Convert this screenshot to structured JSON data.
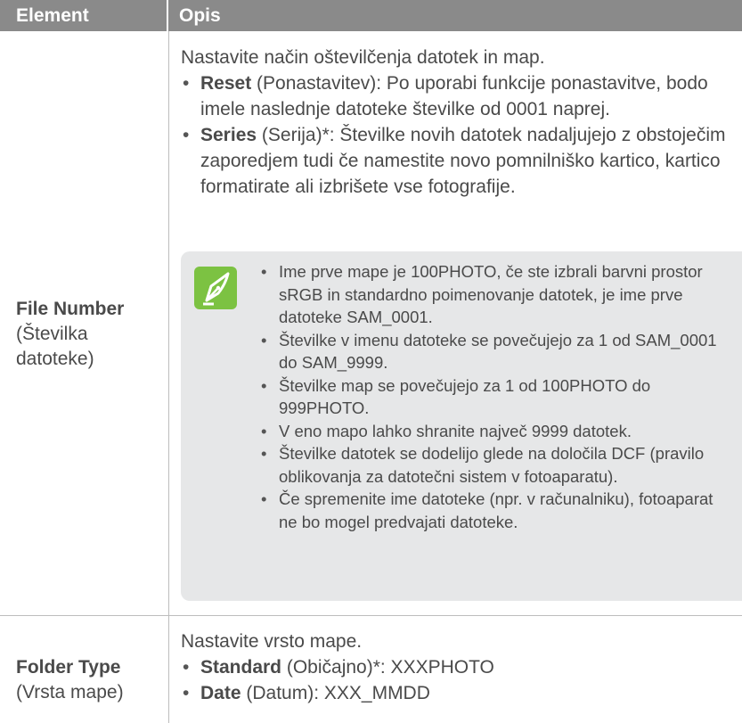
{
  "header": {
    "col1": "Element",
    "col2": "Opis"
  },
  "rows": [
    {
      "label_bold": "File Number",
      "label_sub": "(Številka datoteke)",
      "intro": "Nastavite način oštevilčenja datotek in map.",
      "items": [
        {
          "term": "Reset",
          "text": " (Ponastavitev): Po uporabi funkcije ponastavitve, bodo imele naslednje datoteke številke od 0001 naprej."
        },
        {
          "term": "Series",
          "text": " (Serija)*: Številke novih datotek nadaljujejo z obstoječim zaporedjem tudi če namestite novo pomnilniško kartico, kartico formatirate ali izbrišete vse fotografije."
        }
      ],
      "note": {
        "icon": "pen-nib-icon",
        "items": [
          "Ime prve mape je 100PHOTO, če ste izbrali barvni prostor sRGB in standardno poimenovanje datotek, je ime prve datoteke SAM_0001.",
          "Številke v imenu datoteke se povečujejo za 1 od SAM_0001 do SAM_9999.",
          "Številke map se povečujejo za 1 od 100PHOTO do 999PHOTO.",
          "V eno mapo lahko shranite največ 9999 datotek.",
          "Številke datotek se dodelijo glede na določila DCF (pravilo oblikovanja za datotečni sistem v fotoaparatu).",
          "Če spremenite ime datoteke (npr. v računalniku), fotoaparat ne bo mogel predvajati datoteke."
        ]
      }
    },
    {
      "label_bold": "Folder Type",
      "label_sub": "(Vrsta mape)",
      "intro": "Nastavite vrsto mape.",
      "items": [
        {
          "term": "Standard",
          "text": " (Običajno)*: XXXPHOTO"
        },
        {
          "term": "Date",
          "text": " (Datum): XXX_MMDD"
        }
      ]
    }
  ],
  "colors": {
    "header_bg": "#8a8a8a",
    "note_bg": "#e6e7e8",
    "icon_green": "#7cc242"
  }
}
